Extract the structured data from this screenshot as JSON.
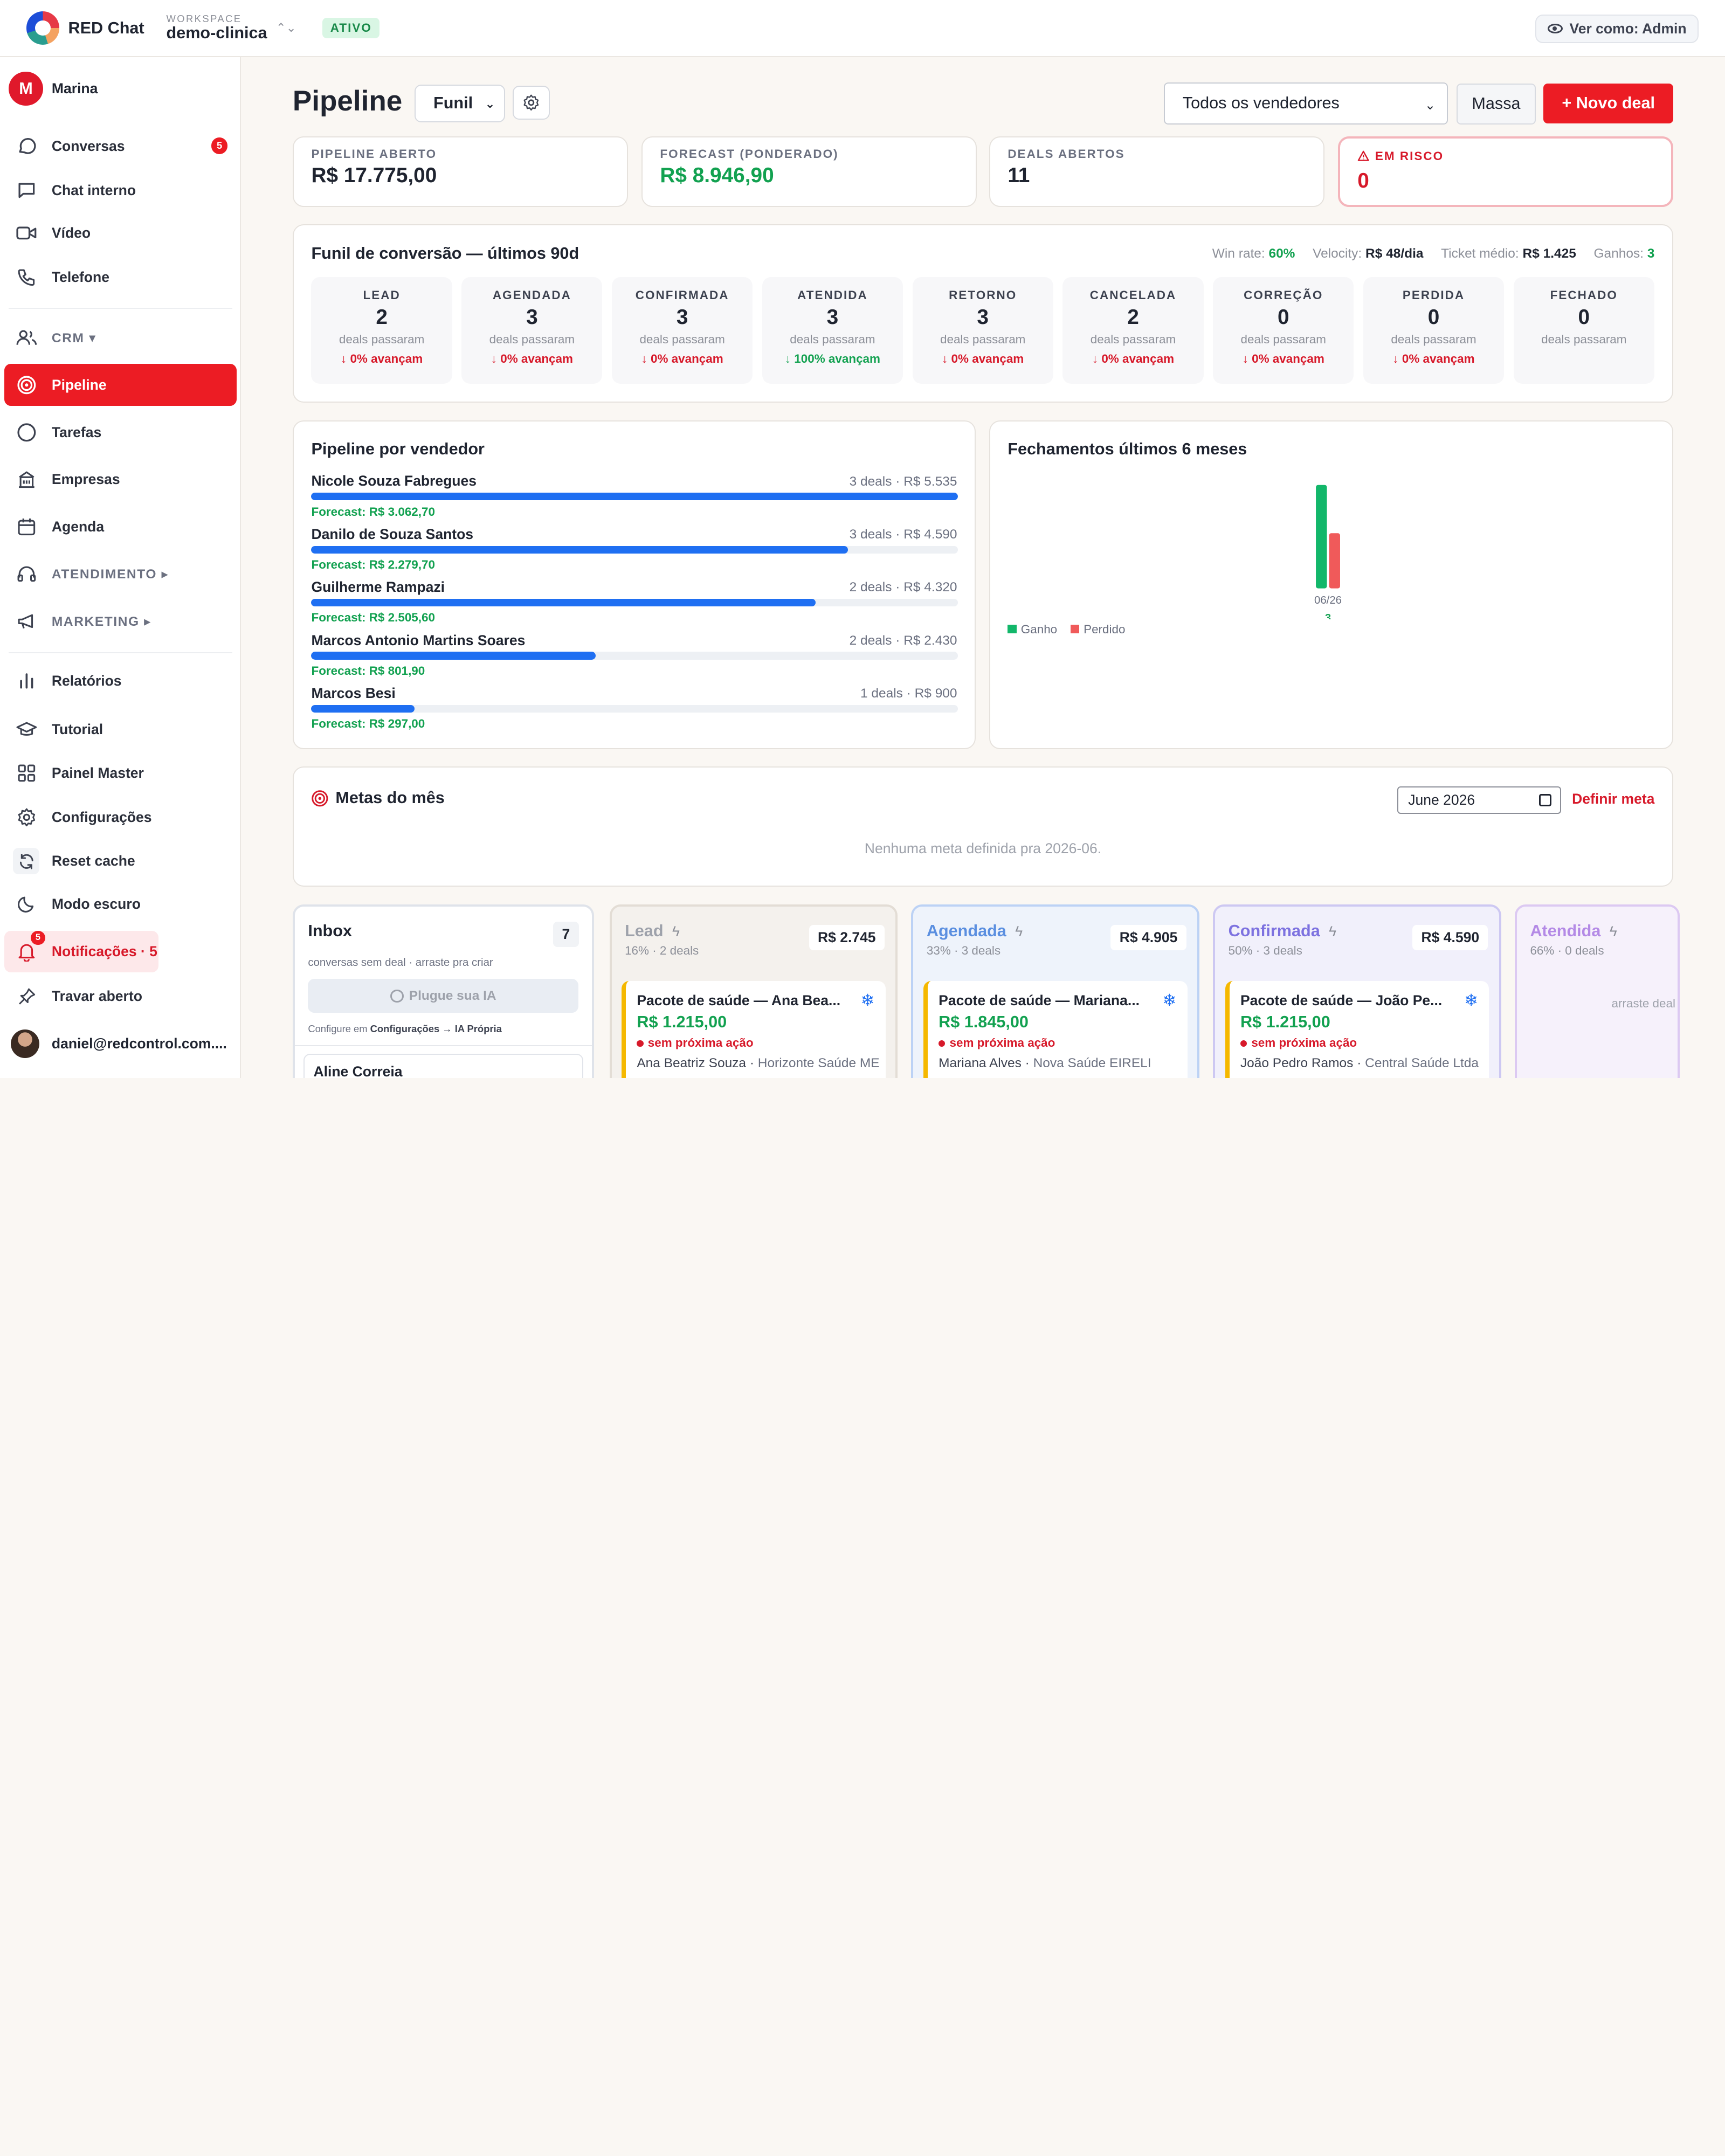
{
  "app": {
    "name": "RED Chat",
    "workspace_label": "WORKSPACE",
    "workspace_name": "demo-clinica",
    "status": "ATIVO",
    "view_as": "Ver como: Admin"
  },
  "sidebar": {
    "user_initial": "M",
    "user_name": "Marina",
    "items": [
      {
        "label": "Conversas",
        "count": "5"
      },
      {
        "label": "Chat interno"
      },
      {
        "label": "Vídeo"
      },
      {
        "label": "Telefone"
      },
      {
        "label": "CRM ▾"
      },
      {
        "label": "Pipeline"
      },
      {
        "label": "Tarefas"
      },
      {
        "label": "Empresas"
      },
      {
        "label": "Agenda"
      },
      {
        "label": "ATENDIMENTO ▸"
      },
      {
        "label": "MARKETING ▸"
      },
      {
        "label": "Relatórios"
      },
      {
        "label": "Tutorial"
      },
      {
        "label": "Painel Master"
      },
      {
        "label": "Configurações"
      },
      {
        "label": "Reset cache"
      },
      {
        "label": "Modo escuro"
      },
      {
        "label": "Notificações · 5",
        "count": "5"
      },
      {
        "label": "Travar aberto"
      }
    ],
    "footer_user": "daniel@redcontrol.com...."
  },
  "header": {
    "title": "Pipeline",
    "view_select": "Funil",
    "seller_select": "Todos os vendedores",
    "bulk_button": "Massa",
    "new_deal_button": "+ Novo deal"
  },
  "kpis": [
    {
      "label": "PIPELINE ABERTO",
      "value": "R$ 17.775,00",
      "color": "#1f2430"
    },
    {
      "label": "FORECAST (PONDERADO)",
      "value": "R$ 8.946,90",
      "color": "#12a150"
    },
    {
      "label": "DEALS ABERTOS",
      "value": "11",
      "color": "#1f2430"
    },
    {
      "label": "EM RISCO",
      "value": "0",
      "color": "#d7192a"
    }
  ],
  "funnel": {
    "title": "Funil de conversão — últimos 90d",
    "stats": [
      {
        "label": "Win rate:",
        "value": "60%"
      },
      {
        "label": "Velocity:",
        "value": "R$ 48/dia"
      },
      {
        "label": "Ticket médio:",
        "value": "R$ 1.425"
      },
      {
        "label": "Ganhos:",
        "value": "3"
      }
    ],
    "stages": [
      {
        "name": "LEAD",
        "value": "2",
        "sub": "deals passaram",
        "pct": "↓ 0% avançam"
      },
      {
        "name": "AGENDADA",
        "value": "3",
        "sub": "deals passaram",
        "pct": "↓ 0% avançam"
      },
      {
        "name": "CONFIRMADA",
        "value": "3",
        "sub": "deals passaram",
        "pct": "↓ 0% avançam"
      },
      {
        "name": "ATENDIDA",
        "value": "3",
        "sub": "deals passaram",
        "pct": "↓ 100% avançam",
        "ok": true
      },
      {
        "name": "RETORNO",
        "value": "3",
        "sub": "deals passaram",
        "pct": "↓ 0% avançam"
      },
      {
        "name": "CANCELADA",
        "value": "2",
        "sub": "deals passaram",
        "pct": "↓ 0% avançam"
      },
      {
        "name": "CORREÇÃO",
        "value": "0",
        "sub": "deals passaram",
        "pct": "↓ 0% avançam"
      },
      {
        "name": "PERDIDA",
        "value": "0",
        "sub": "deals passaram",
        "pct": "↓ 0% avançam"
      },
      {
        "name": "FECHADO",
        "value": "0",
        "sub": "deals passaram",
        "pct": ""
      }
    ]
  },
  "vendors": {
    "title": "Pipeline por vendedor",
    "rows": [
      {
        "name": "Nicole Souza Fabregues",
        "info": "3 deals · R$ 5.535",
        "forecast": "Forecast: R$ 3.062,70",
        "share": 1.0
      },
      {
        "name": "Danilo de Souza Santos",
        "info": "3 deals · R$ 4.590",
        "forecast": "Forecast: R$ 2.279,70",
        "share": 0.83
      },
      {
        "name": "Guilherme Rampazi",
        "info": "2 deals · R$ 4.320",
        "forecast": "Forecast: R$ 2.505,60",
        "share": 0.78
      },
      {
        "name": "Marcos Antonio Martins Soares",
        "info": "2 deals · R$ 2.430",
        "forecast": "Forecast: R$ 801,90",
        "share": 0.44
      },
      {
        "name": "Marcos Besi",
        "info": "1 deals · R$ 900",
        "forecast": "Forecast: R$ 297,00",
        "share": 0.16
      }
    ]
  },
  "chart_title": "Fechamentos últimos 6 meses",
  "chart_data": {
    "type": "bar",
    "title": "Fechamentos últimos 6 meses",
    "categories": [
      "06/26"
    ],
    "category_totals": [
      "3"
    ],
    "series": [
      {
        "name": "Ganho",
        "values": [
          3
        ],
        "color": "#12b76a"
      },
      {
        "name": "Perdido",
        "values": [
          1.6
        ],
        "color": "#f05a5a"
      }
    ],
    "legend": "bottom-left",
    "grid": false
  },
  "goals": {
    "title": "Metas do mês",
    "month": "June 2026",
    "define_link": "Definir meta",
    "empty": "Nenhuma meta definida pra 2026-06."
  },
  "kanban": {
    "inbox": {
      "title": "Inbox",
      "count": "7",
      "hint": "conversas sem deal · arraste pra criar",
      "ai_button": "Plugue sua IA",
      "config_note": "Configure em",
      "config_link": "Configurações → IA Própria",
      "first_item": "Aline Correia"
    },
    "columns": [
      {
        "name": "Lead",
        "sub": "16% · 2 deals",
        "total": "R$ 2.745",
        "deal": {
          "title": "Pacote de saúde — Ana Bea...",
          "value": "R$ 1.215,00",
          "warn": "sem próxima ação",
          "person": "Ana Beatriz Souza",
          "company": "Horizonte Saúde ME"
        }
      },
      {
        "name": "Agendada",
        "sub": "33% · 3 deals",
        "total": "R$ 4.905",
        "deal": {
          "title": "Pacote de saúde — Mariana...",
          "value": "R$ 1.845,00",
          "warn": "sem próxima ação",
          "person": "Mariana Alves",
          "company": "Nova Saúde EIRELI"
        }
      },
      {
        "name": "Confirmada",
        "sub": "50% · 3 deals",
        "total": "R$ 4.590",
        "deal": {
          "title": "Pacote de saúde — João Pe...",
          "value": "R$ 1.215,00",
          "warn": "sem próxima ação",
          "person": "João Pedro Ramos",
          "company": "Central Saúde Ltda"
        }
      },
      {
        "name": "Atendida",
        "sub": "66% · 0 deals",
        "drop_hint": "arraste deal"
      }
    ]
  }
}
